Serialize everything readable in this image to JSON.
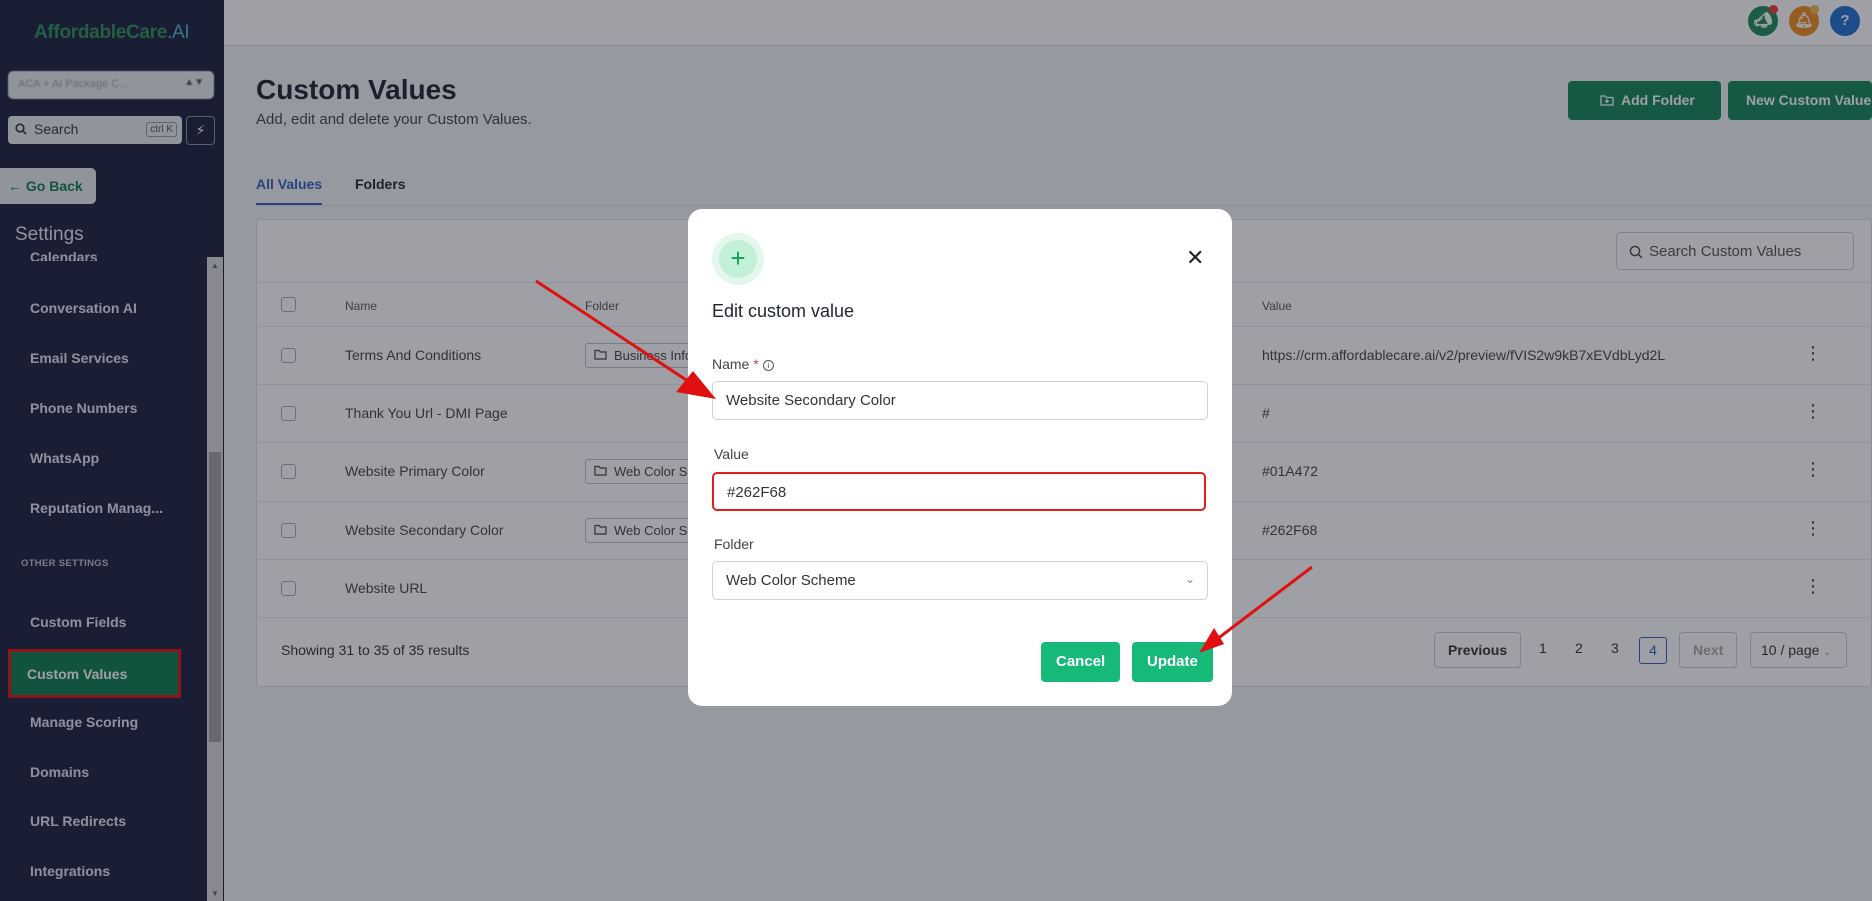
{
  "brand": {
    "logo_main": "AffordableCare",
    "logo_suffix": ".AI"
  },
  "sidebar": {
    "account_value": "ACA + AI Package C...",
    "search_placeholder": "Search",
    "search_shortcut": "ctrl K",
    "go_back_label": "Go Back",
    "settings_title": "Settings",
    "clipped_item": "Calendars",
    "items": [
      {
        "label": "Conversation AI"
      },
      {
        "label": "Email Services"
      },
      {
        "label": "Phone Numbers"
      },
      {
        "label": "WhatsApp"
      },
      {
        "label": "Reputation Manag..."
      }
    ],
    "section_other": "OTHER SETTINGS",
    "other_items": [
      {
        "label": "Custom Fields"
      },
      {
        "label": "Custom Values"
      },
      {
        "label": "Manage Scoring"
      },
      {
        "label": "Domains"
      },
      {
        "label": "URL Redirects"
      },
      {
        "label": "Integrations"
      }
    ]
  },
  "topbar": {
    "help_glyph": "?"
  },
  "page": {
    "title": "Custom Values",
    "subtitle": "Add, edit and delete your Custom Values.",
    "add_folder_label": "Add Folder",
    "new_value_label": "New Custom Value",
    "tabs": [
      {
        "label": "All Values"
      },
      {
        "label": "Folders"
      }
    ]
  },
  "table": {
    "search_placeholder": "Search Custom Values",
    "headers": {
      "name": "Name",
      "folder": "Folder",
      "value": "Value"
    },
    "rows": [
      {
        "name": "Terms And Conditions",
        "folder": "Business Info",
        "value": "https://crm.affordablecare.ai/v2/preview/fVIS2w9kB7xEVdbLyd2L"
      },
      {
        "name": "Thank You Url - DMI Page",
        "folder": "",
        "value": "#"
      },
      {
        "name": "Website Primary Color",
        "folder": "Web Color Scheme",
        "value": "#01A472"
      },
      {
        "name": "Website Secondary Color",
        "folder": "Web Color Scheme",
        "value": "#262F68"
      },
      {
        "name": "Website URL",
        "folder": "",
        "value": ""
      }
    ],
    "showing_text": "Showing 31 to 35 of 35 results",
    "pagination": {
      "previous": "Previous",
      "pages": [
        "1",
        "2",
        "3",
        "4"
      ],
      "current_page": "4",
      "next": "Next",
      "per_page": "10 / page"
    }
  },
  "modal": {
    "title": "Edit custom value",
    "name_label": "Name",
    "required_mark": "*",
    "name_value": "Website Secondary Color",
    "value_label": "Value",
    "value_value": "#262F68",
    "folder_label": "Folder",
    "folder_value": "Web Color Scheme",
    "cancel_label": "Cancel",
    "update_label": "Update"
  },
  "colors": {
    "sidebar_bg": "#1b1f3f",
    "brand_green": "#14865a",
    "modal_button_green": "#17b978",
    "active_tab_blue": "#2f5fbd",
    "annotation_red": "#e01010"
  }
}
